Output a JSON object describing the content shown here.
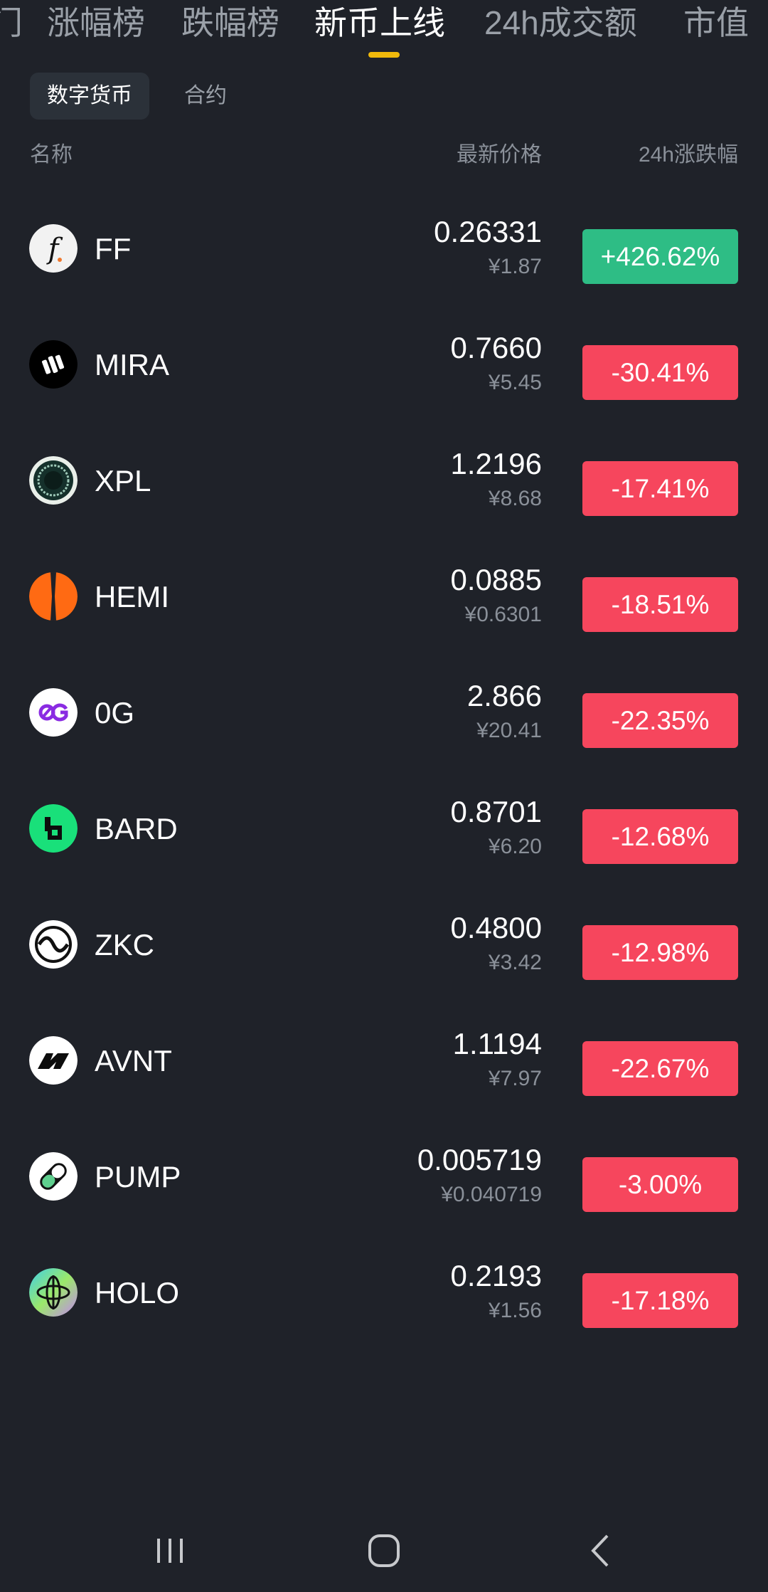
{
  "tabs": [
    {
      "label": "门",
      "active": false
    },
    {
      "label": "涨幅榜",
      "active": false
    },
    {
      "label": "跌幅榜",
      "active": false
    },
    {
      "label": "新币上线",
      "active": true
    },
    {
      "label": "24h成交额",
      "active": false
    },
    {
      "label": "市值",
      "active": false
    }
  ],
  "segments": [
    {
      "label": "数字货币",
      "active": true
    },
    {
      "label": "合约",
      "active": false
    }
  ],
  "columns": {
    "name": "名称",
    "price": "最新价格",
    "change": "24h涨跌幅"
  },
  "coins": [
    {
      "symbol": "FF",
      "price": "0.26331",
      "fiat": "¥1.87",
      "change": "+426.62%",
      "direction": "up",
      "icon": "ff-coin-icon"
    },
    {
      "symbol": "MIRA",
      "price": "0.7660",
      "fiat": "¥5.45",
      "change": "-30.41%",
      "direction": "down",
      "icon": "mira-coin-icon"
    },
    {
      "symbol": "XPL",
      "price": "1.2196",
      "fiat": "¥8.68",
      "change": "-17.41%",
      "direction": "down",
      "icon": "xpl-coin-icon"
    },
    {
      "symbol": "HEMI",
      "price": "0.0885",
      "fiat": "¥0.6301",
      "change": "-18.51%",
      "direction": "down",
      "icon": "hemi-coin-icon"
    },
    {
      "symbol": "0G",
      "price": "2.866",
      "fiat": "¥20.41",
      "change": "-22.35%",
      "direction": "down",
      "icon": "0g-coin-icon"
    },
    {
      "symbol": "BARD",
      "price": "0.8701",
      "fiat": "¥6.20",
      "change": "-12.68%",
      "direction": "down",
      "icon": "bard-coin-icon"
    },
    {
      "symbol": "ZKC",
      "price": "0.4800",
      "fiat": "¥3.42",
      "change": "-12.98%",
      "direction": "down",
      "icon": "zkc-coin-icon"
    },
    {
      "symbol": "AVNT",
      "price": "1.1194",
      "fiat": "¥7.97",
      "change": "-22.67%",
      "direction": "down",
      "icon": "avnt-coin-icon"
    },
    {
      "symbol": "PUMP",
      "price": "0.005719",
      "fiat": "¥0.040719",
      "change": "-3.00%",
      "direction": "down",
      "icon": "pump-coin-icon"
    },
    {
      "symbol": "HOLO",
      "price": "0.2193",
      "fiat": "¥1.56",
      "change": "-17.18%",
      "direction": "down",
      "icon": "holo-coin-icon"
    }
  ],
  "colors": {
    "background": "#1f2229",
    "up": "#2ebd85",
    "down": "#f6465d",
    "accent": "#f0b90b"
  },
  "navbar": {
    "icons": [
      "recent-apps-icon",
      "home-icon",
      "back-icon"
    ]
  }
}
